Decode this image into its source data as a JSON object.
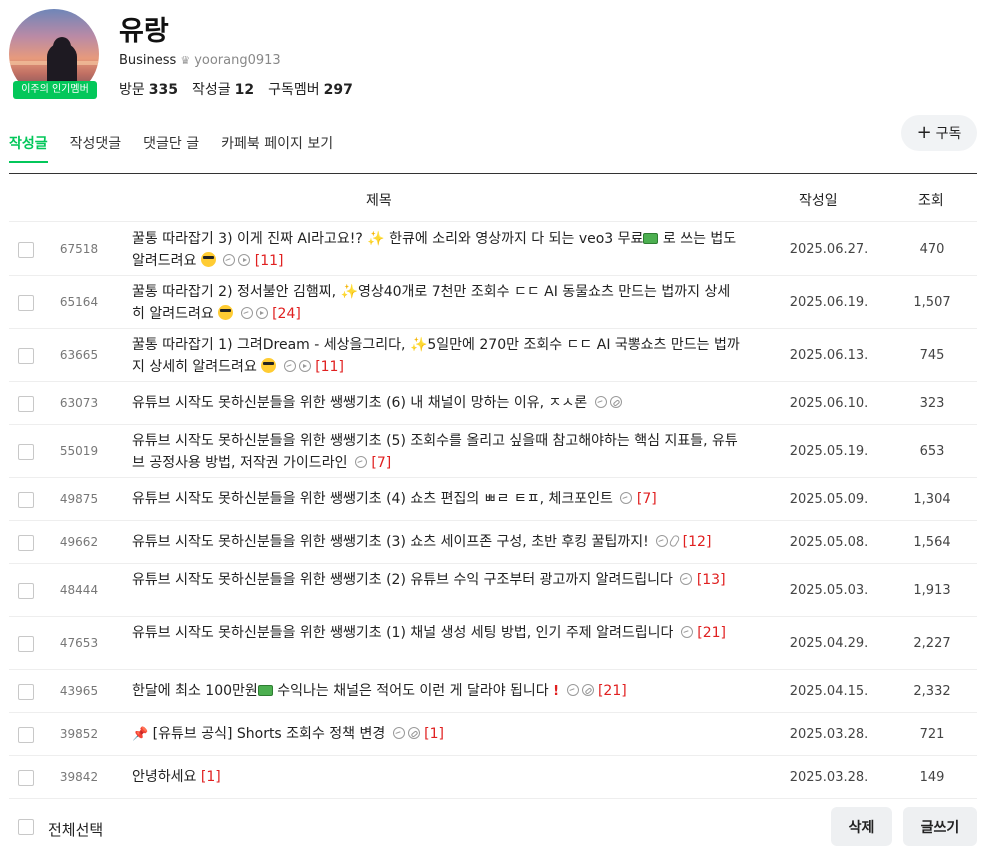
{
  "profile": {
    "nickname": "유랑",
    "grade": "Business",
    "user_id": "yoorang0913",
    "badge": "이주의 인기멤버",
    "stats": [
      {
        "label": "방문",
        "value": "335"
      },
      {
        "label": "작성글",
        "value": "12"
      },
      {
        "label": "구독멤버",
        "value": "297"
      }
    ]
  },
  "tabs": [
    "작성글",
    "작성댓글",
    "댓글단 글",
    "카페북 페이지 보기"
  ],
  "active_tab": "작성글",
  "subscribe_label": "구독",
  "table": {
    "headers": {
      "title": "제목",
      "date": "작성일",
      "views": "조회"
    },
    "rows": [
      {
        "num": "67518",
        "title_a": "꿀통 따라잡기 3) 이게 진짜 AI라고요!?",
        "title_b": "한큐에 소리와 영상까지 다 되는 veo3 무료",
        "title_c": "로 쓰는 법도 알려드려요",
        "comments": "[11]",
        "date": "2025.06.27.",
        "views": "470"
      },
      {
        "num": "65164",
        "title_a": "꿀통 따라잡기 2) 정서불안 김햄찌,",
        "title_b": "영상40개로 7천만 조회수 ㄷㄷ AI 동물쇼츠 만드는 법까지 상세히 알려드려요",
        "comments": "[24]",
        "date": "2025.06.19.",
        "views": "1,507"
      },
      {
        "num": "63665",
        "title_a": "꿀통 따라잡기 1) 그려Dream - 세상을그리다,",
        "title_b": "5일만에 270만 조회수 ㄷㄷ AI 국뽕쇼츠 만드는 법까지 상세히 알려드려요",
        "comments": "[11]",
        "date": "2025.06.13.",
        "views": "745"
      },
      {
        "num": "63073",
        "title_a": "유튜브 시작도 못하신분들을 위한 쌩쌩기초 (6) 내 채널이 망하는 이유, ㅈㅅ론",
        "comments": "",
        "date": "2025.06.10.",
        "views": "323"
      },
      {
        "num": "55019",
        "title_a": "유튜브 시작도 못하신분들을 위한 쌩쌩기초 (5) 조회수를 올리고 싶을때 참고해야하는 핵심 지표들, 유튜브 공정사용 방법, 저작권 가이드라인",
        "comments": "[7]",
        "date": "2025.05.19.",
        "views": "653"
      },
      {
        "num": "49875",
        "title_a": "유튜브 시작도 못하신분들을 위한 쌩쌩기초 (4) 쇼츠 편집의 ㅃㄹ ㅌㅍ, 체크포인트",
        "comments": "[7]",
        "date": "2025.05.09.",
        "views": "1,304"
      },
      {
        "num": "49662",
        "title_a": "유튜브 시작도 못하신분들을 위한 쌩쌩기초 (3) 쇼츠 세이프존 구성, 초반 후킹 꿀팁까지!",
        "comments": "[12]",
        "date": "2025.05.08.",
        "views": "1,564"
      },
      {
        "num": "48444",
        "title_a": "유튜브 시작도 못하신분들을 위한 쌩쌩기초 (2) 유튜브 수익 구조부터 광고까지 알려드립니다",
        "comments": "[13]",
        "date": "2025.05.03.",
        "views": "1,913"
      },
      {
        "num": "47653",
        "title_a": "유튜브 시작도 못하신분들을 위한 쌩쌩기초 (1) 채널 생성 세팅 방법, 인기 주제 알려드립니다",
        "comments": "[21]",
        "date": "2025.04.29.",
        "views": "2,227"
      },
      {
        "num": "43965",
        "title_a": "한달에 최소 100만원",
        "title_b": "수익나는 채널은 적어도 이런 게 달라야 됩니다",
        "comments": "[21]",
        "date": "2025.04.15.",
        "views": "2,332"
      },
      {
        "num": "39852",
        "title_a": "[유튜브 공식] Shorts 조회수 정책 변경",
        "comments": "[1]",
        "date": "2025.03.28.",
        "views": "721"
      },
      {
        "num": "39842",
        "title_a": "안녕하세요",
        "comments": "[1]",
        "date": "2025.03.28.",
        "views": "149"
      }
    ]
  },
  "footer": {
    "select_all": "전체선택",
    "delete": "삭제",
    "write": "글쓰기"
  },
  "colors": {
    "accent": "#03c75a",
    "comment": "#e02020"
  }
}
